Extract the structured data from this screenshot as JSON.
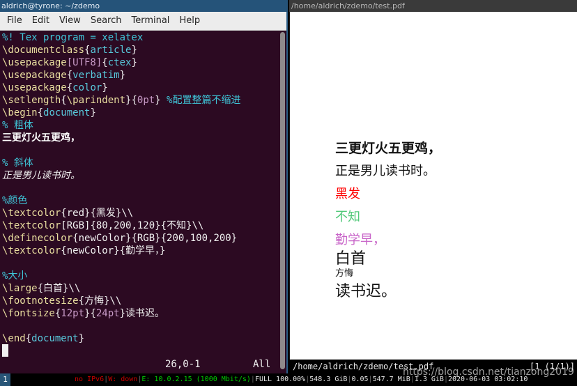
{
  "terminal": {
    "title": "aldrich@tyrone: ~/zdemo",
    "menu": [
      "File",
      "Edit",
      "View",
      "Search",
      "Terminal",
      "Help"
    ],
    "lines": [
      [
        {
          "t": "%! Tex program = xelatex",
          "c": "cmt"
        }
      ],
      [
        {
          "t": "\\documentclass",
          "c": "cmd"
        },
        {
          "t": "{",
          "c": "txt"
        },
        {
          "t": "article",
          "c": "arg"
        },
        {
          "t": "}",
          "c": "txt"
        }
      ],
      [
        {
          "t": "\\usepackage",
          "c": "cmd"
        },
        {
          "t": "[UTF8]",
          "c": "opt"
        },
        {
          "t": "{",
          "c": "txt"
        },
        {
          "t": "ctex",
          "c": "arg"
        },
        {
          "t": "}",
          "c": "txt"
        }
      ],
      [
        {
          "t": "\\usepackage",
          "c": "cmd"
        },
        {
          "t": "{",
          "c": "txt"
        },
        {
          "t": "verbatim",
          "c": "arg"
        },
        {
          "t": "}",
          "c": "txt"
        }
      ],
      [
        {
          "t": "\\usepackage",
          "c": "cmd"
        },
        {
          "t": "{",
          "c": "txt"
        },
        {
          "t": "color",
          "c": "arg"
        },
        {
          "t": "}",
          "c": "txt"
        }
      ],
      [
        {
          "t": "\\setlength",
          "c": "cmd"
        },
        {
          "t": "{",
          "c": "txt"
        },
        {
          "t": "\\parindent",
          "c": "cmd"
        },
        {
          "t": "}{",
          "c": "txt"
        },
        {
          "t": "0pt",
          "c": "opt"
        },
        {
          "t": "} ",
          "c": "txt"
        },
        {
          "t": "%配置整篇不缩进",
          "c": "cmt"
        }
      ],
      [
        {
          "t": "\\begin",
          "c": "cmd"
        },
        {
          "t": "{",
          "c": "txt"
        },
        {
          "t": "document",
          "c": "arg"
        },
        {
          "t": "}",
          "c": "txt"
        }
      ],
      [
        {
          "t": "% 粗体",
          "c": "cmt"
        }
      ],
      [
        {
          "t": "三更灯火五更鸡，",
          "c": "bold"
        }
      ],
      [],
      [
        {
          "t": "% 斜体",
          "c": "cmt"
        }
      ],
      [
        {
          "t": "正是男儿读书时。",
          "c": "ital"
        }
      ],
      [],
      [
        {
          "t": "%颜色",
          "c": "cmt"
        }
      ],
      [
        {
          "t": "\\textcolor",
          "c": "cmd"
        },
        {
          "t": "{red}{黑发}\\\\",
          "c": "txt"
        }
      ],
      [
        {
          "t": "\\textcolor",
          "c": "cmd"
        },
        {
          "t": "[RGB]{80,200,120}{不知}\\\\",
          "c": "txt"
        }
      ],
      [
        {
          "t": "\\definecolor",
          "c": "cmd"
        },
        {
          "t": "{newColor}{RGB}{200,100,200}",
          "c": "txt"
        }
      ],
      [
        {
          "t": "\\textcolor",
          "c": "cmd"
        },
        {
          "t": "{newColor}{勤学早，}",
          "c": "txt"
        }
      ],
      [],
      [
        {
          "t": "%大小",
          "c": "cmt"
        }
      ],
      [
        {
          "t": "\\large",
          "c": "cmd"
        },
        {
          "t": "{白首}\\\\",
          "c": "txt"
        }
      ],
      [
        {
          "t": "\\footnotesize",
          "c": "cmd"
        },
        {
          "t": "{方悔}\\\\",
          "c": "txt"
        }
      ],
      [
        {
          "t": "\\fontsize",
          "c": "cmd"
        },
        {
          "t": "{",
          "c": "txt"
        },
        {
          "t": "12pt",
          "c": "opt"
        },
        {
          "t": "}{",
          "c": "txt"
        },
        {
          "t": "24pt",
          "c": "opt"
        },
        {
          "t": "}读书迟。",
          "c": "txt"
        }
      ],
      [],
      [
        {
          "t": "\\end",
          "c": "cmd"
        },
        {
          "t": "{",
          "c": "txt"
        },
        {
          "t": "document",
          "c": "arg"
        },
        {
          "t": "}",
          "c": "txt"
        }
      ]
    ],
    "cursor_pos": "26,0-1",
    "scroll_pos": "All"
  },
  "pdf": {
    "title": "/home/aldrich/zdemo/test.pdf",
    "status_path": "/home/aldrich/zdemo/test.pdf",
    "status_page": "[1 (1/1)]",
    "lines": [
      {
        "text": "三更灯火五更鸡，",
        "color": "#111111",
        "style": "bold"
      },
      {
        "text": "正是男儿读书时。",
        "color": "#111111",
        "style": "normal"
      },
      {
        "text": "黑发",
        "color": "#ff0000",
        "style": "normal"
      },
      {
        "text": "不知",
        "color": "#50c878",
        "style": "normal"
      },
      {
        "text": "勤学早，",
        "color": "#c864c8",
        "style": "normal"
      },
      {
        "text": "白首",
        "color": "#111111",
        "style": "large"
      },
      {
        "text": "方悔",
        "color": "#111111",
        "style": "small"
      },
      {
        "text": "读书迟。",
        "color": "#111111",
        "style": "large"
      }
    ]
  },
  "statusbar": {
    "workspace": "1",
    "items": [
      {
        "text": "no IPv6",
        "color": "#cc0000"
      },
      {
        "text": "W: down",
        "color": "#cc0000"
      },
      {
        "text": "E: 10.0.2.15 (1000 Mbit/s)",
        "color": "#00cc00"
      },
      {
        "text": "FULL 100.00%",
        "color": "#e6e6e6"
      },
      {
        "text": "548.3 GiB",
        "color": "#e6e6e6"
      },
      {
        "text": "0.05",
        "color": "#e6e6e6"
      },
      {
        "text": "547.7 MiB",
        "color": "#e6e6e6"
      },
      {
        "text": "1.3 GiB",
        "color": "#e6e6e6"
      },
      {
        "text": "2020-06-03 03:02:10",
        "color": "#e6e6e6"
      }
    ],
    "separator_color": "#666666"
  },
  "watermark": "https://blog.csdn.net/tianzong2019"
}
